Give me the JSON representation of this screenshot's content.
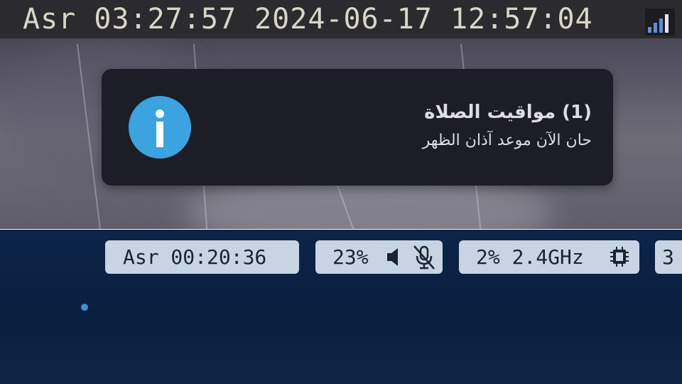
{
  "top_panel": {
    "clock_text": "Asr 03:27:57 2024-06-17 12:57:04",
    "signal_icon": "signal-strength-icon",
    "notification": {
      "icon": "info-icon",
      "title": "(1) مواقيت الصلاة",
      "body": "حان الآن موعد آذان الظهر",
      "accent_color": "#3aa3e0"
    }
  },
  "bottom_panel": {
    "prayer_pill": {
      "text": "Asr 00:20:36"
    },
    "audio_pill": {
      "volume": "23%",
      "speaker_icon": "speaker-icon",
      "mic_icon": "mic-muted-icon"
    },
    "cpu_pill": {
      "text": "2% 2.4GHz",
      "icon": "cpu-chip-icon"
    },
    "next_pill": {
      "text": "3"
    },
    "pill_color": "#c7d5e3"
  }
}
